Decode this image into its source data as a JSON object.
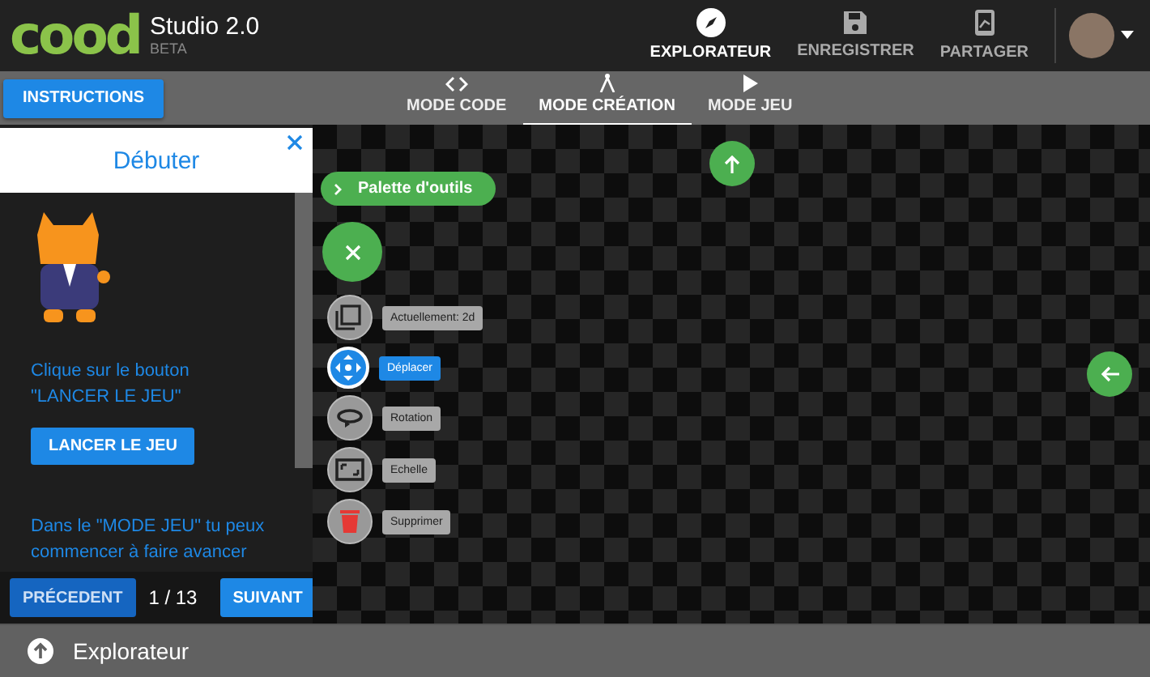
{
  "header": {
    "logo": "cood",
    "title": "Studio 2.0",
    "subtitle": "BETA",
    "nav": [
      {
        "label": "EXPLORATEUR",
        "selected": true
      },
      {
        "label": "ENREGISTRER",
        "selected": false
      },
      {
        "label": "PARTAGER",
        "selected": false
      }
    ]
  },
  "modebar": {
    "instructions_button": "INSTRUCTIONS",
    "tabs": [
      {
        "label": "MODE CODE",
        "selected": false
      },
      {
        "label": "MODE CRÉATION",
        "selected": true
      },
      {
        "label": "MODE JEU",
        "selected": false
      }
    ]
  },
  "panel": {
    "title": "Débuter",
    "instruction": "Clique sur le bouton \"LANCER LE JEU\"",
    "action_button": "LANCER LE JEU",
    "paragraph": "Dans le \"MODE JEU\" tu peux commencer à faire avancer",
    "previous_button": "PRÉCEDENT",
    "page": "1 / 13",
    "next_button": "SUIVANT"
  },
  "canvas": {
    "palette_button": "Palette d'outils",
    "tools": [
      {
        "label": "Actuellement: 2d",
        "selected": false
      },
      {
        "label": "Déplacer",
        "selected": true
      },
      {
        "label": "Rotation",
        "selected": false
      },
      {
        "label": "Echelle",
        "selected": false
      },
      {
        "label": "Supprimer",
        "selected": false
      }
    ]
  },
  "footer": {
    "label": "Explorateur"
  }
}
